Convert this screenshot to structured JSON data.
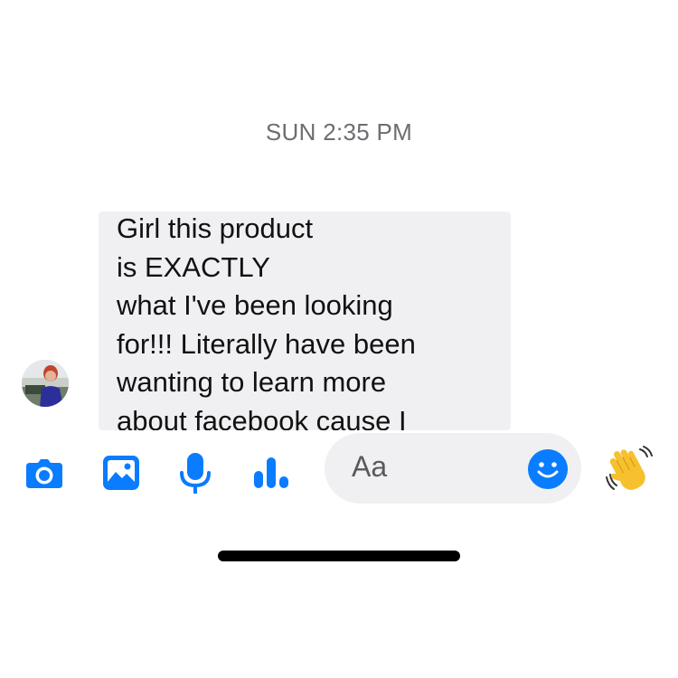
{
  "timestamp": "SUN 2:35 PM",
  "message": {
    "lines": [
      "Girl this product",
      "is EXACTLY",
      "what I've been looking",
      "for!!! Literally have been",
      "wanting to learn more",
      "about facebook cause I"
    ]
  },
  "composer": {
    "icons": [
      "camera-icon",
      "photo-icon",
      "microphone-icon",
      "chart-icon"
    ],
    "input_placeholder": "Aa",
    "emoji_icon": "smiley-icon",
    "quick_reaction": "waving-hand-icon"
  },
  "colors": {
    "accent": "#0a7cff",
    "bubble": "#f0f0f3",
    "input": "#f0f0f2",
    "timestamp": "#6d6d72"
  }
}
